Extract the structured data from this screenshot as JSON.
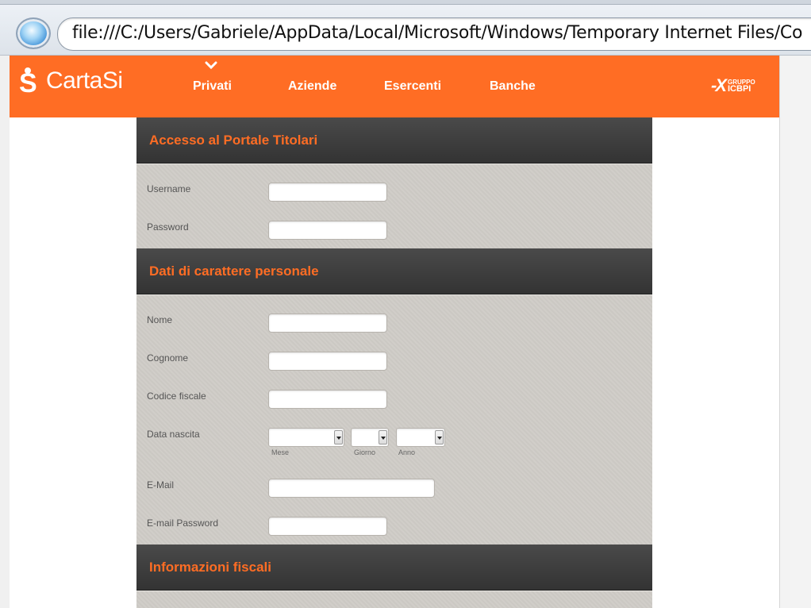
{
  "browser": {
    "address": "file:///C:/Users/Gabriele/AppData/Local/Microsoft/Windows/Temporary Internet Files/Co"
  },
  "brand": {
    "logo_text": "CartaSi",
    "group_x": "-X",
    "group_line1": "GRUPPO",
    "group_line2": "ICBPI"
  },
  "nav": {
    "items": [
      {
        "label": "Privati"
      },
      {
        "label": "Aziende"
      },
      {
        "label": "Esercenti"
      },
      {
        "label": "Banche"
      }
    ]
  },
  "sections": {
    "accesso": {
      "title": "Accesso al Portale Titolari",
      "username_label": "Username",
      "username_value": "",
      "password_label": "Password",
      "password_value": ""
    },
    "personali": {
      "title": "Dati di carattere personale",
      "nome_label": "Nome",
      "nome_value": "",
      "cognome_label": "Cognome",
      "cognome_value": "",
      "codice_label": "Codice fiscale",
      "codice_value": "",
      "data_label": "Data nascita",
      "mese_label": "Mese",
      "giorno_label": "Giorno",
      "anno_label": "Anno",
      "email_label": "E-Mail",
      "email_value": "",
      "email_password_label": "E-mail Password",
      "email_password_value": ""
    },
    "fiscali": {
      "title": "Informazioni fiscali"
    }
  },
  "colors": {
    "accent": "#ff6d24",
    "header_dark": "#3a3a3a",
    "body_bg": "#cfccc7"
  }
}
